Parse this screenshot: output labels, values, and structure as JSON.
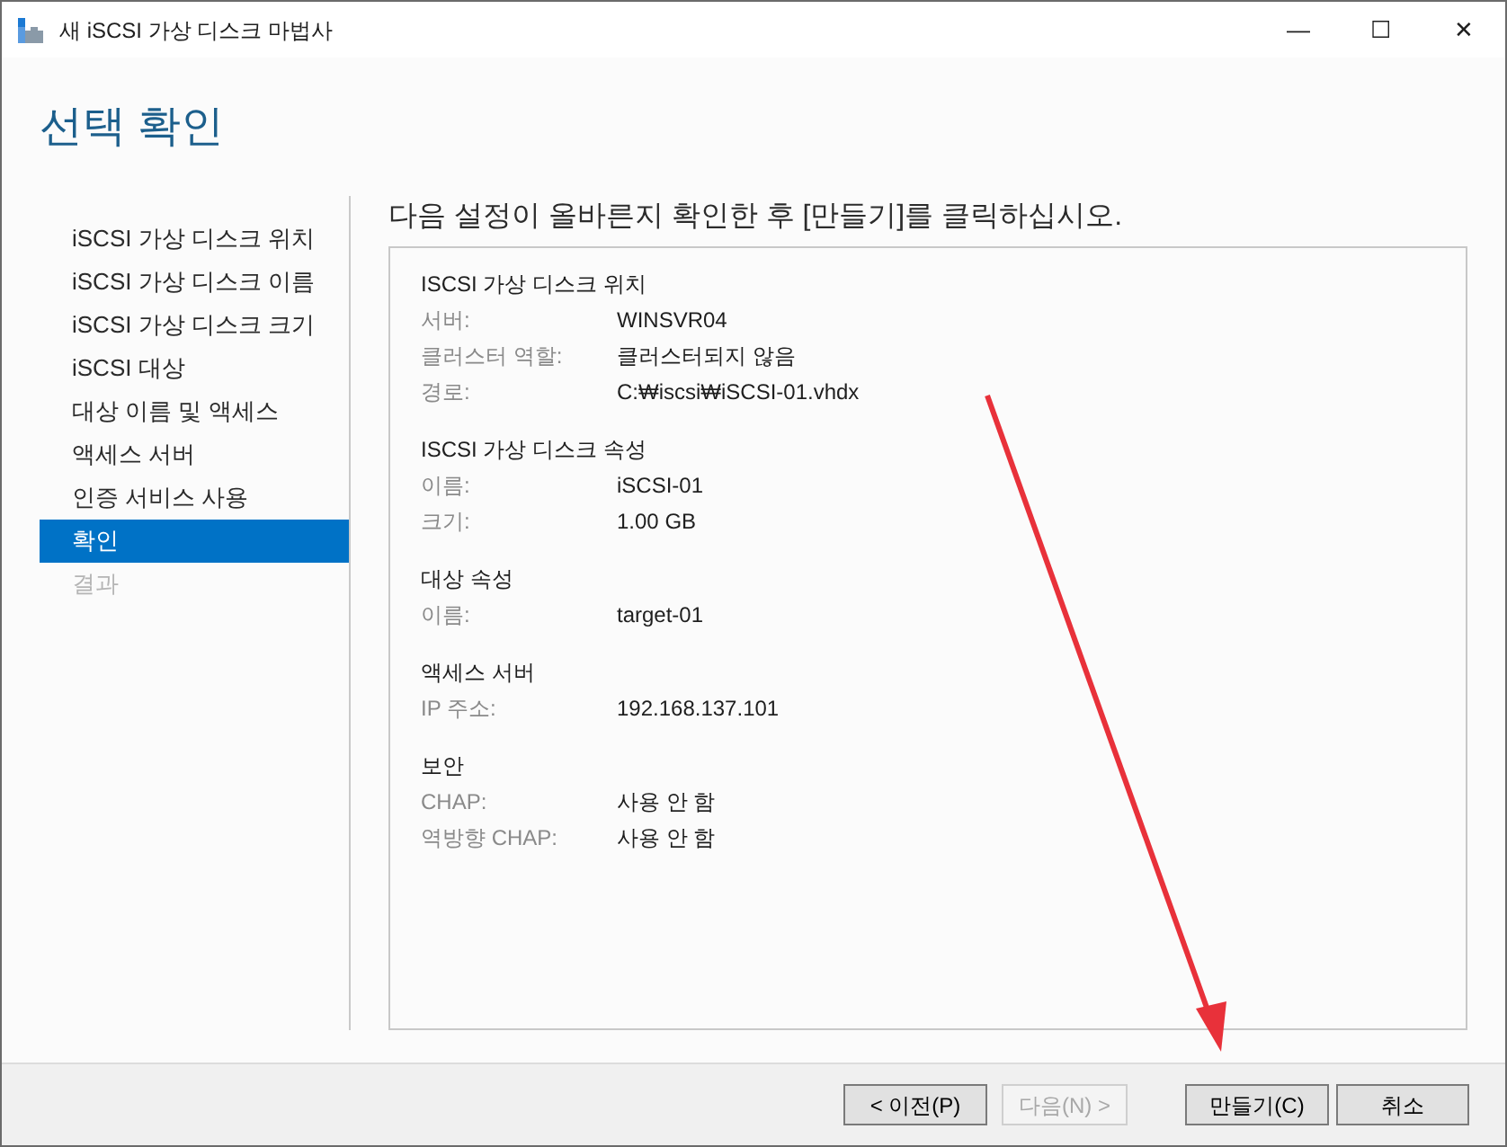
{
  "window": {
    "title": "새 iSCSI 가상 디스크 마법사",
    "controls": [
      "—",
      "☐",
      "✕"
    ]
  },
  "page_title": "선택 확인",
  "steps": [
    {
      "label": "iSCSI 가상 디스크 위치",
      "selected": false,
      "disabled": false
    },
    {
      "label": "iSCSI 가상 디스크 이름",
      "selected": false,
      "disabled": false
    },
    {
      "label": "iSCSI 가상 디스크 크기",
      "selected": false,
      "disabled": false
    },
    {
      "label": "iSCSI 대상",
      "selected": false,
      "disabled": false
    },
    {
      "label": "대상 이름 및 액세스",
      "selected": false,
      "disabled": false
    },
    {
      "label": "액세스 서버",
      "selected": false,
      "disabled": false
    },
    {
      "label": "인증 서비스 사용",
      "selected": false,
      "disabled": false
    },
    {
      "label": "확인",
      "selected": true,
      "disabled": false
    },
    {
      "label": "결과",
      "selected": false,
      "disabled": true
    }
  ],
  "instruction": "다음 설정이 올바른지 확인한 후 [만들기]를 클릭하십시오.",
  "sections": [
    {
      "heading": "ISCSI 가상 디스크 위치",
      "rows": [
        {
          "label": "서버:",
          "value": "WINSVR04"
        },
        {
          "label": "클러스터 역할:",
          "value": "클러스터되지 않음"
        },
        {
          "label": "경로:",
          "value": "C:₩iscsi₩iSCSI-01.vhdx"
        }
      ]
    },
    {
      "heading": "ISCSI 가상 디스크 속성",
      "rows": [
        {
          "label": "이름:",
          "value": "iSCSI-01"
        },
        {
          "label": "크기:",
          "value": "1.00 GB"
        }
      ]
    },
    {
      "heading": "대상 속성",
      "rows": [
        {
          "label": "이름:",
          "value": "target-01"
        }
      ]
    },
    {
      "heading": "액세스 서버",
      "rows": [
        {
          "label": "IP 주소:",
          "value": "192.168.137.101"
        }
      ]
    },
    {
      "heading": "보안",
      "rows": [
        {
          "label": "CHAP:",
          "value": "사용 안 함"
        },
        {
          "label": "역방향 CHAP:",
          "value": "사용 안 함"
        }
      ]
    }
  ],
  "buttons": [
    {
      "label": "< 이전(P)",
      "disabled": false
    },
    {
      "label": "다음(N) >",
      "disabled": true
    },
    {
      "label": "만들기(C)",
      "disabled": false
    },
    {
      "label": "취소",
      "disabled": false
    }
  ]
}
